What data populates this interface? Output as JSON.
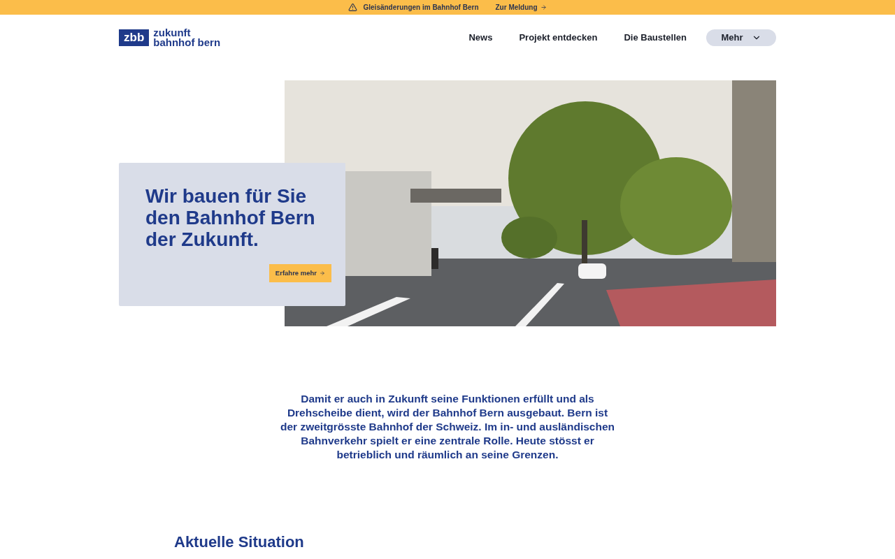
{
  "banner": {
    "text": "Gleisänderungen im Bahnhof Bern",
    "link": "Zur Meldung"
  },
  "logo": {
    "mark": "zbb",
    "lines": [
      "zukunft",
      "bahnhof bern"
    ]
  },
  "nav": [
    {
      "label": "News",
      "kind": "link"
    },
    {
      "label": "Projekt entdecken",
      "kind": "link"
    },
    {
      "label": "Die Baustellen",
      "kind": "link"
    },
    {
      "label": "Mehr",
      "kind": "menu"
    }
  ],
  "hero": {
    "title": "Wir bauen für Sie den Bahnhof Bern der Zukunft.",
    "button": "Erfahre mehr"
  },
  "intro": "Damit er auch in Zukunft seine Funktionen erfüllt und als Drehscheibe dient, wird der Bahnhof Bern ausgebaut. Bern ist der zweitgrösste Bahnhof der Schweiz. Im in- und ausländischen Bahnverkehr spielt er eine zentrale Rolle. Heute stösst er betrieblich und räumlich an seine Grenzen.",
  "section_title": "Aktuelle Situation"
}
